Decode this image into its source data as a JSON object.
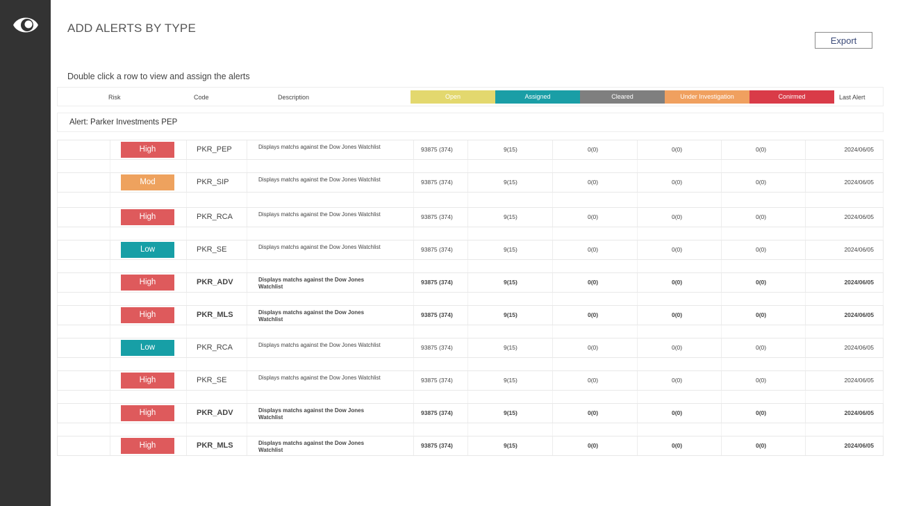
{
  "app": {
    "title": "ADD ALERTS BY TYPE",
    "export_label": "Export",
    "instructions": "Double click a row to view and assign the alerts"
  },
  "columns": {
    "risk": "Risk",
    "code": "Code",
    "description": "Description",
    "open": "Open",
    "assigned": "Assigned",
    "cleared": "Cleared",
    "under_investigation": "Under Investigation",
    "confirmed": "Conirmed",
    "last_alert": "Last Alert"
  },
  "colors": {
    "sidebar": "#333333",
    "open": "#e3d86e",
    "assigned": "#1a9ea6",
    "cleared": "#7f7f7f",
    "under_investigation": "#f0a05f",
    "confirmed": "#d93b48",
    "risk_high": "#de5a5c",
    "risk_mod": "#eea25e",
    "risk_low": "#179fa6"
  },
  "group": {
    "label": "Alert: Parker Investments PEP"
  },
  "rows": [
    {
      "risk": "High",
      "code": "PKR_PEP",
      "desc": "Displays matchs against the Dow Jones Watchlist",
      "open": "93875 (374)",
      "assigned": "9(15)",
      "cleared": "0(0)",
      "under_investigation": "0(0)",
      "confirmed": "0(0)",
      "last_alert": "2024/06/05",
      "bold": false
    },
    {
      "risk": "Mod",
      "code": "PKR_SIP",
      "desc": "Displays matchs against the Dow Jones Watchlist",
      "open": "93875 (374)",
      "assigned": "9(15)",
      "cleared": "0(0)",
      "under_investigation": "0(0)",
      "confirmed": "0(0)",
      "last_alert": "2024/06/05",
      "bold": false
    },
    {
      "risk": "High",
      "code": "PKR_RCA",
      "desc": "Displays matchs against the Dow Jones Watchlist",
      "open": "93875 (374)",
      "assigned": "9(15)",
      "cleared": "0(0)",
      "under_investigation": "0(0)",
      "confirmed": "0(0)",
      "last_alert": "2024/06/05",
      "bold": false
    },
    {
      "risk": "Low",
      "code": "PKR_SE",
      "desc": "Displays matchs against the Dow Jones Watchlist",
      "open": "93875 (374)",
      "assigned": "9(15)",
      "cleared": "0(0)",
      "under_investigation": "0(0)",
      "confirmed": "0(0)",
      "last_alert": "2024/06/05",
      "bold": false
    },
    {
      "risk": "High",
      "code": "PKR_ADV",
      "desc": "Displays matchs against the Dow Jones Watchlist",
      "open": "93875 (374)",
      "assigned": "9(15)",
      "cleared": "0(0)",
      "under_investigation": "0(0)",
      "confirmed": "0(0)",
      "last_alert": "2024/06/05",
      "bold": true
    },
    {
      "risk": "High",
      "code": "PKR_MLS",
      "desc": "Displays matchs against the Dow Jones Watchlist",
      "open": "93875 (374)",
      "assigned": "9(15)",
      "cleared": "0(0)",
      "under_investigation": "0(0)",
      "confirmed": "0(0)",
      "last_alert": "2024/06/05",
      "bold": true
    },
    {
      "risk": "Low",
      "code": "PKR_RCA",
      "desc": "Displays matchs against the Dow Jones Watchlist",
      "open": "93875 (374)",
      "assigned": "9(15)",
      "cleared": "0(0)",
      "under_investigation": "0(0)",
      "confirmed": "0(0)",
      "last_alert": "2024/06/05",
      "bold": false
    },
    {
      "risk": "High",
      "code": "PKR_SE",
      "desc": "Displays matchs against the Dow Jones Watchlist",
      "open": "93875 (374)",
      "assigned": "9(15)",
      "cleared": "0(0)",
      "under_investigation": "0(0)",
      "confirmed": "0(0)",
      "last_alert": "2024/06/05",
      "bold": false
    },
    {
      "risk": "High",
      "code": "PKR_ADV",
      "desc": "Displays matchs against the Dow Jones Watchlist",
      "open": "93875 (374)",
      "assigned": "9(15)",
      "cleared": "0(0)",
      "under_investigation": "0(0)",
      "confirmed": "0(0)",
      "last_alert": "2024/06/05",
      "bold": true
    },
    {
      "risk": "High",
      "code": "PKR_MLS",
      "desc": "Displays matchs against the Dow Jones Watchlist",
      "open": "93875 (374)",
      "assigned": "9(15)",
      "cleared": "0(0)",
      "under_investigation": "0(0)",
      "confirmed": "0(0)",
      "last_alert": "2024/06/05",
      "bold": true
    }
  ]
}
